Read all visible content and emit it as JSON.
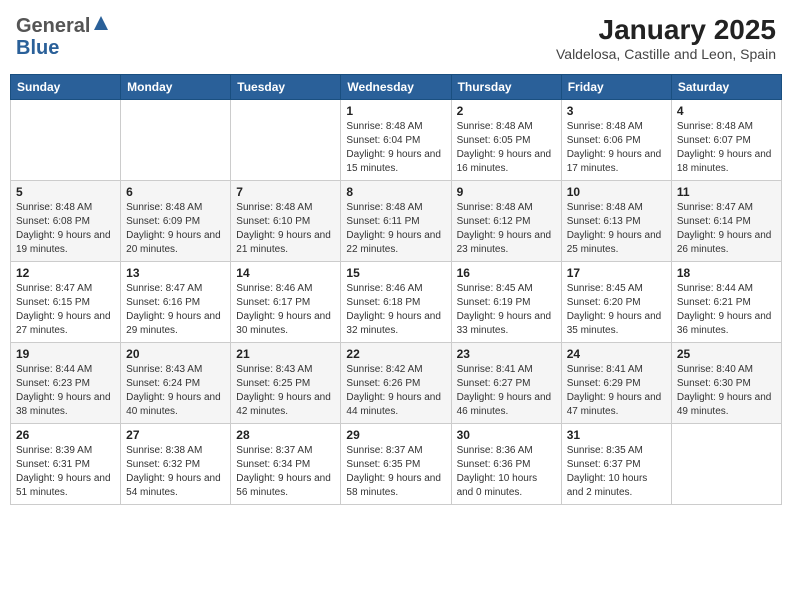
{
  "header": {
    "logo_general": "General",
    "logo_blue": "Blue",
    "title": "January 2025",
    "subtitle": "Valdelosa, Castille and Leon, Spain"
  },
  "weekdays": [
    "Sunday",
    "Monday",
    "Tuesday",
    "Wednesday",
    "Thursday",
    "Friday",
    "Saturday"
  ],
  "weeks": [
    [
      {
        "day": "",
        "info": ""
      },
      {
        "day": "",
        "info": ""
      },
      {
        "day": "",
        "info": ""
      },
      {
        "day": "1",
        "info": "Sunrise: 8:48 AM\nSunset: 6:04 PM\nDaylight: 9 hours and 15 minutes."
      },
      {
        "day": "2",
        "info": "Sunrise: 8:48 AM\nSunset: 6:05 PM\nDaylight: 9 hours and 16 minutes."
      },
      {
        "day": "3",
        "info": "Sunrise: 8:48 AM\nSunset: 6:06 PM\nDaylight: 9 hours and 17 minutes."
      },
      {
        "day": "4",
        "info": "Sunrise: 8:48 AM\nSunset: 6:07 PM\nDaylight: 9 hours and 18 minutes."
      }
    ],
    [
      {
        "day": "5",
        "info": "Sunrise: 8:48 AM\nSunset: 6:08 PM\nDaylight: 9 hours and 19 minutes."
      },
      {
        "day": "6",
        "info": "Sunrise: 8:48 AM\nSunset: 6:09 PM\nDaylight: 9 hours and 20 minutes."
      },
      {
        "day": "7",
        "info": "Sunrise: 8:48 AM\nSunset: 6:10 PM\nDaylight: 9 hours and 21 minutes."
      },
      {
        "day": "8",
        "info": "Sunrise: 8:48 AM\nSunset: 6:11 PM\nDaylight: 9 hours and 22 minutes."
      },
      {
        "day": "9",
        "info": "Sunrise: 8:48 AM\nSunset: 6:12 PM\nDaylight: 9 hours and 23 minutes."
      },
      {
        "day": "10",
        "info": "Sunrise: 8:48 AM\nSunset: 6:13 PM\nDaylight: 9 hours and 25 minutes."
      },
      {
        "day": "11",
        "info": "Sunrise: 8:47 AM\nSunset: 6:14 PM\nDaylight: 9 hours and 26 minutes."
      }
    ],
    [
      {
        "day": "12",
        "info": "Sunrise: 8:47 AM\nSunset: 6:15 PM\nDaylight: 9 hours and 27 minutes."
      },
      {
        "day": "13",
        "info": "Sunrise: 8:47 AM\nSunset: 6:16 PM\nDaylight: 9 hours and 29 minutes."
      },
      {
        "day": "14",
        "info": "Sunrise: 8:46 AM\nSunset: 6:17 PM\nDaylight: 9 hours and 30 minutes."
      },
      {
        "day": "15",
        "info": "Sunrise: 8:46 AM\nSunset: 6:18 PM\nDaylight: 9 hours and 32 minutes."
      },
      {
        "day": "16",
        "info": "Sunrise: 8:45 AM\nSunset: 6:19 PM\nDaylight: 9 hours and 33 minutes."
      },
      {
        "day": "17",
        "info": "Sunrise: 8:45 AM\nSunset: 6:20 PM\nDaylight: 9 hours and 35 minutes."
      },
      {
        "day": "18",
        "info": "Sunrise: 8:44 AM\nSunset: 6:21 PM\nDaylight: 9 hours and 36 minutes."
      }
    ],
    [
      {
        "day": "19",
        "info": "Sunrise: 8:44 AM\nSunset: 6:23 PM\nDaylight: 9 hours and 38 minutes."
      },
      {
        "day": "20",
        "info": "Sunrise: 8:43 AM\nSunset: 6:24 PM\nDaylight: 9 hours and 40 minutes."
      },
      {
        "day": "21",
        "info": "Sunrise: 8:43 AM\nSunset: 6:25 PM\nDaylight: 9 hours and 42 minutes."
      },
      {
        "day": "22",
        "info": "Sunrise: 8:42 AM\nSunset: 6:26 PM\nDaylight: 9 hours and 44 minutes."
      },
      {
        "day": "23",
        "info": "Sunrise: 8:41 AM\nSunset: 6:27 PM\nDaylight: 9 hours and 46 minutes."
      },
      {
        "day": "24",
        "info": "Sunrise: 8:41 AM\nSunset: 6:29 PM\nDaylight: 9 hours and 47 minutes."
      },
      {
        "day": "25",
        "info": "Sunrise: 8:40 AM\nSunset: 6:30 PM\nDaylight: 9 hours and 49 minutes."
      }
    ],
    [
      {
        "day": "26",
        "info": "Sunrise: 8:39 AM\nSunset: 6:31 PM\nDaylight: 9 hours and 51 minutes."
      },
      {
        "day": "27",
        "info": "Sunrise: 8:38 AM\nSunset: 6:32 PM\nDaylight: 9 hours and 54 minutes."
      },
      {
        "day": "28",
        "info": "Sunrise: 8:37 AM\nSunset: 6:34 PM\nDaylight: 9 hours and 56 minutes."
      },
      {
        "day": "29",
        "info": "Sunrise: 8:37 AM\nSunset: 6:35 PM\nDaylight: 9 hours and 58 minutes."
      },
      {
        "day": "30",
        "info": "Sunrise: 8:36 AM\nSunset: 6:36 PM\nDaylight: 10 hours and 0 minutes."
      },
      {
        "day": "31",
        "info": "Sunrise: 8:35 AM\nSunset: 6:37 PM\nDaylight: 10 hours and 2 minutes."
      },
      {
        "day": "",
        "info": ""
      }
    ]
  ]
}
